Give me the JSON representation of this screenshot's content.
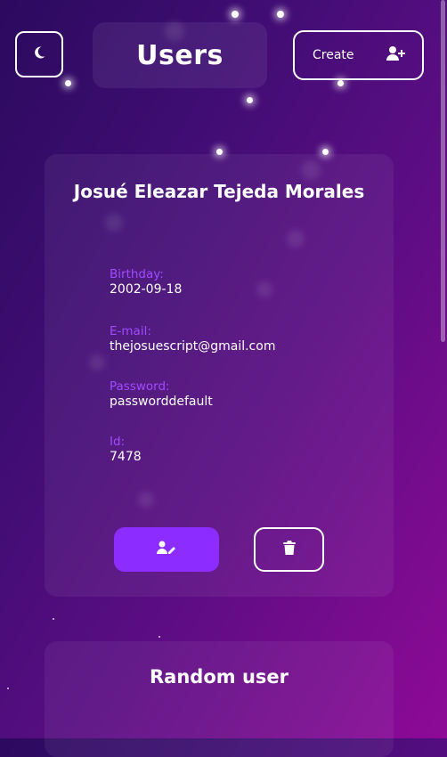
{
  "header": {
    "title": "Users",
    "create_label": "Create",
    "theme_icon": "moon-icon",
    "create_icon": "user-plus-icon"
  },
  "user_card": {
    "name": "Josué Eleazar Tejeda Morales",
    "fields": [
      {
        "label": "Birthday:",
        "value": "2002-09-18"
      },
      {
        "label": "E-mail:",
        "value": "thejosuescript@gmail.com"
      },
      {
        "label": "Password:",
        "value": "passworddefault"
      },
      {
        "label": "Id:",
        "value": "7478"
      }
    ],
    "edit_icon": "user-edit-icon",
    "delete_icon": "trash-icon"
  },
  "random_card": {
    "title": "Random user"
  },
  "colors": {
    "accent": "#8c2cff",
    "label": "#a04bff",
    "bg_start": "#2c0a5e",
    "bg_end": "#8e0a97"
  }
}
